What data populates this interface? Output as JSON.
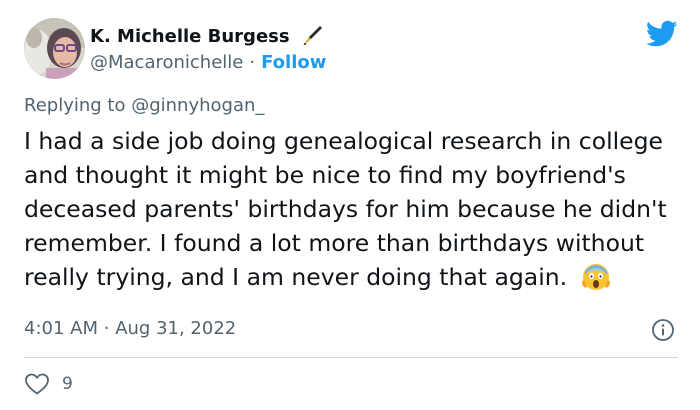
{
  "author": {
    "display_name": "K. Michelle Burgess",
    "handle": "@Macaronichelle",
    "separator": "·",
    "follow_label": "Follow",
    "name_badge_icon": "fountain-pen-icon",
    "avatar_icon": "avatar"
  },
  "brand": {
    "icon": "twitter-bird-icon",
    "color": "#1d9bf0"
  },
  "reply": {
    "prefix": "Replying to",
    "target": "@ginnyhogan_"
  },
  "tweet": {
    "text": "I had a side job doing genealogical research in college and thought it might be nice to find my boyfriend's deceased parents' birthdays for him because he didn't remember. I found a lot more than birthdays without really trying, and I am never doing that again.",
    "emoji_icon": "face-screaming-in-fear-icon"
  },
  "meta": {
    "time": "4:01 AM",
    "separator": "·",
    "date": "Aug 31, 2022",
    "info_icon": "info-icon"
  },
  "actions": {
    "like_icon": "heart-icon",
    "like_count": "9"
  },
  "colors": {
    "text_primary": "#0f1419",
    "text_secondary": "#536471",
    "accent": "#1d9bf0",
    "divider": "#cfd9de"
  }
}
